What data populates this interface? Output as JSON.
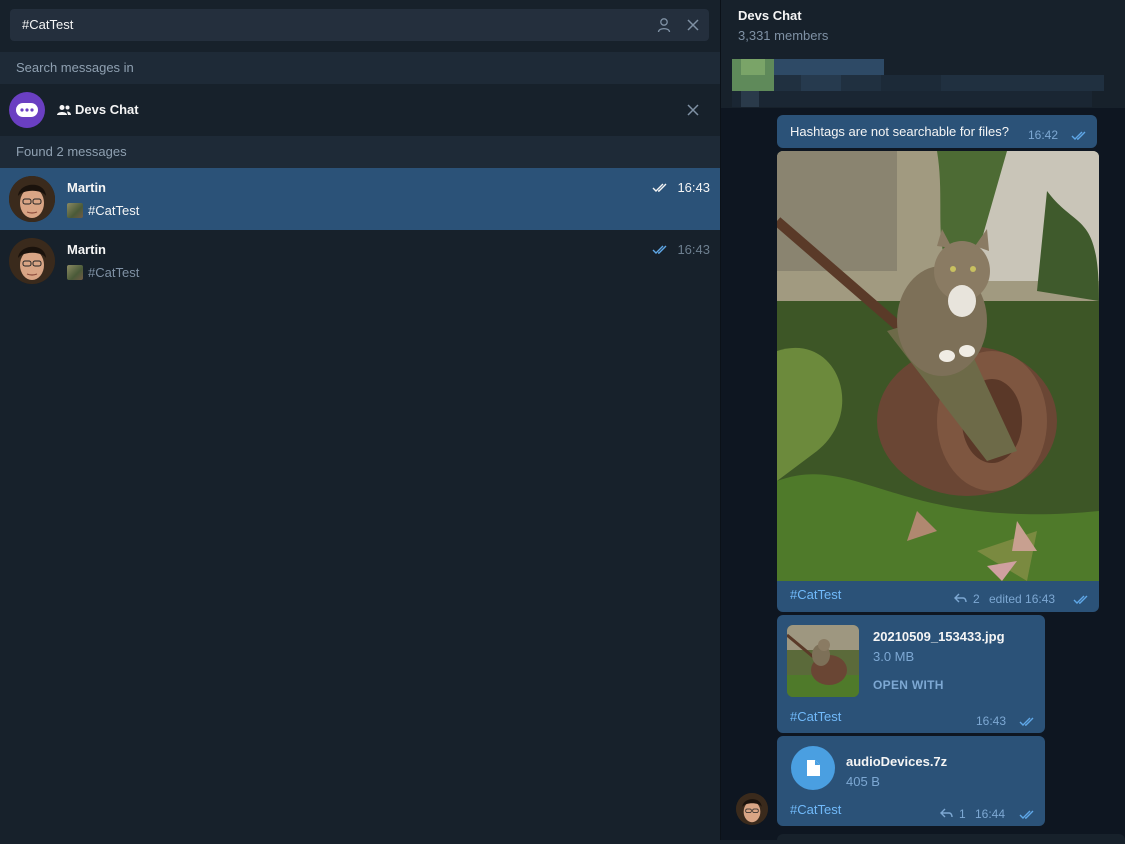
{
  "search": {
    "query": "#CatTest",
    "search_in_label": "Search messages in",
    "scope_name": "Devs Chat",
    "found_label": "Found 2 messages"
  },
  "results": [
    {
      "name": "Martin",
      "time": "16:43",
      "text": "#CatTest",
      "active": true
    },
    {
      "name": "Martin",
      "time": "16:43",
      "text": "#CatTest",
      "active": false
    }
  ],
  "chat": {
    "title": "Devs Chat",
    "members": "3,331 members",
    "messages": {
      "text_msg": {
        "text": "Hashtags are not searchable for files?",
        "time": "16:42"
      },
      "photo_msg": {
        "caption": "#CatTest",
        "replies": "2",
        "edited": "edited 16:43"
      },
      "file_msg": {
        "file_name": "20210509_153433.jpg",
        "file_size": "3.0 MB",
        "action": "OPEN WITH",
        "caption": "#CatTest",
        "time": "16:43"
      },
      "doc_msg": {
        "file_name": "audioDevices.7z",
        "file_size": "405 B",
        "caption": "#CatTest",
        "replies": "1",
        "time": "16:44"
      }
    }
  },
  "colors": {
    "sidebar_bg": "#17212b",
    "active_row": "#2b5278",
    "bubble": "#2b5278",
    "link": "#71bafa",
    "scope_avatar": "#6a3fc2"
  }
}
